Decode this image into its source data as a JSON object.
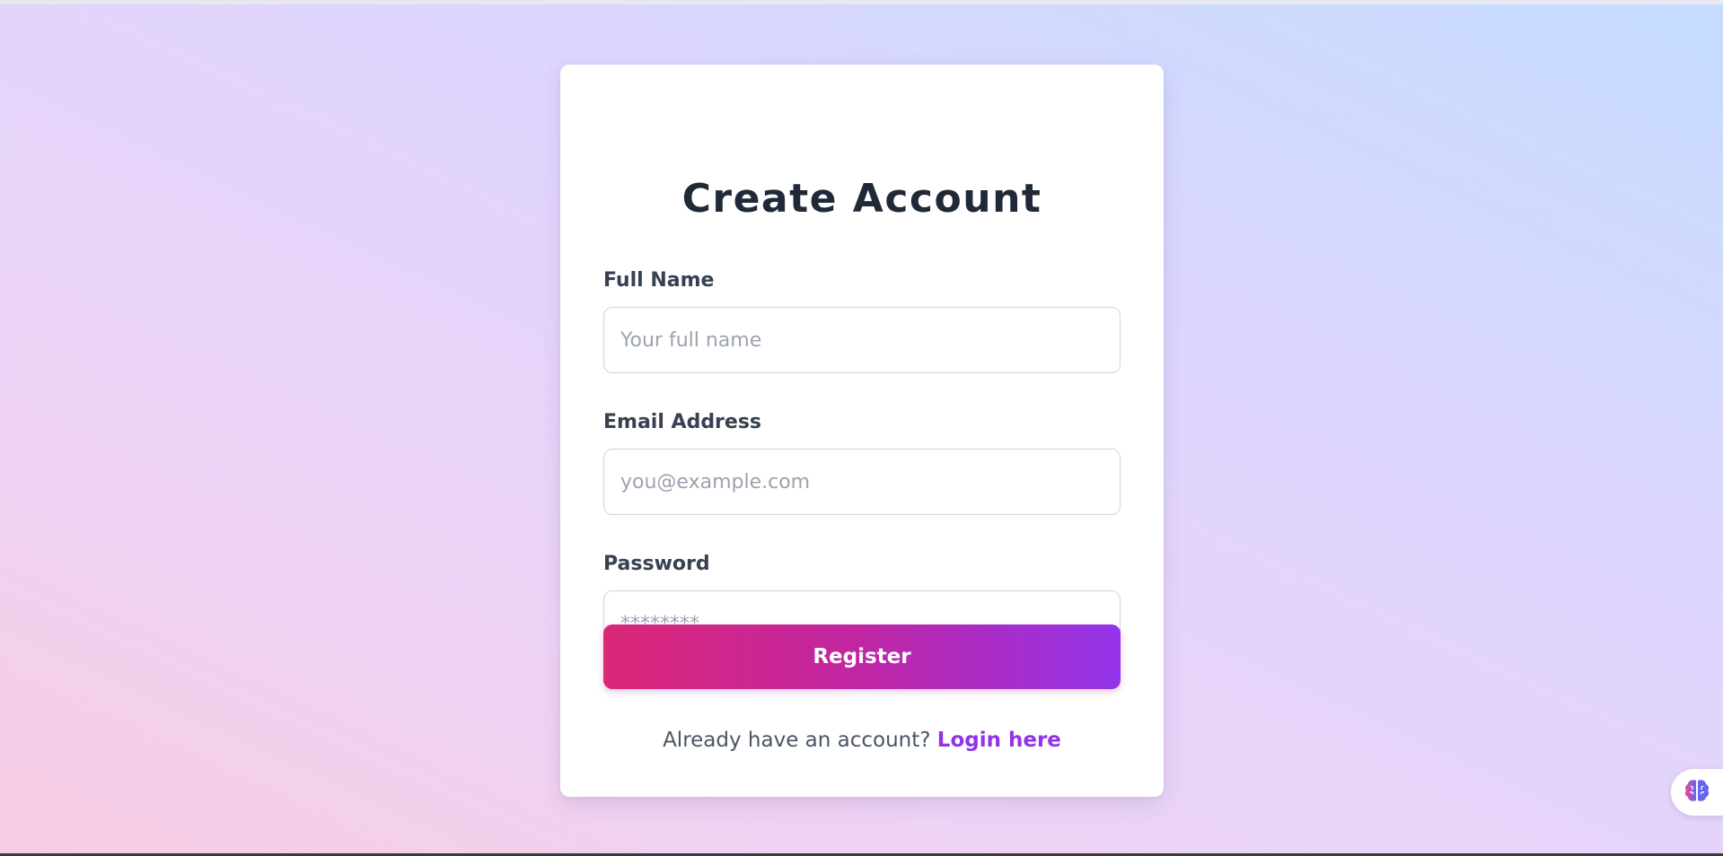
{
  "page": {
    "title": "Create Account"
  },
  "form": {
    "full_name": {
      "label": "Full Name",
      "placeholder": "Your full name",
      "value": ""
    },
    "email": {
      "label": "Email Address",
      "placeholder": "you@example.com",
      "value": ""
    },
    "password": {
      "label": "Password",
      "placeholder": "********",
      "value": ""
    },
    "submit_label": "Register"
  },
  "footer": {
    "prompt": "Already have an account?",
    "link_label": "Login here"
  },
  "widget": {
    "icon": "brain-icon"
  },
  "colors": {
    "accent_start": "#db2777",
    "accent_end": "#9333ea",
    "link": "#9333ea",
    "heading": "#1f2937"
  }
}
